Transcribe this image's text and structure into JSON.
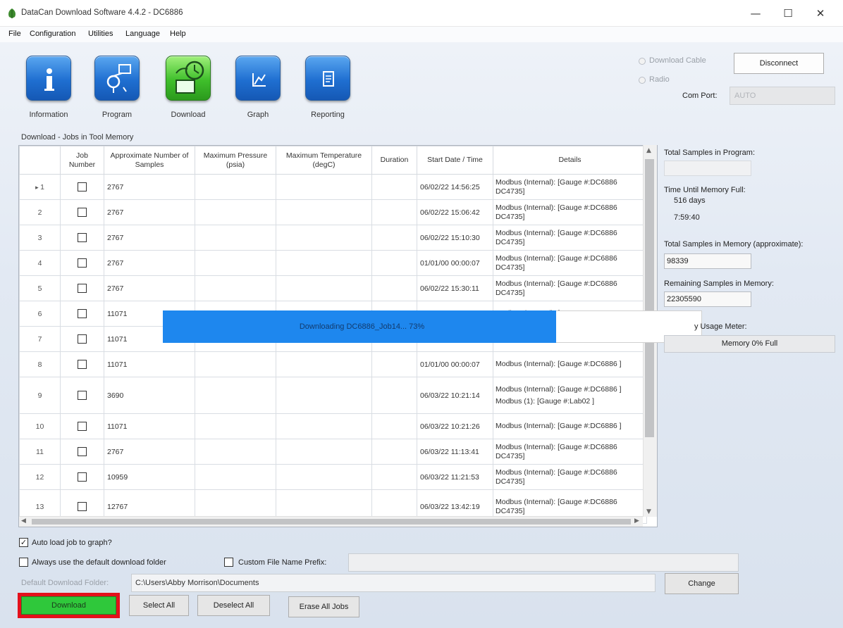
{
  "window": {
    "title": "DataCan Download Software 4.4.2 - DC6886",
    "minimize": "—",
    "maximize": "☐",
    "close": "✕"
  },
  "menu": [
    "File",
    "Configuration",
    "Utilities",
    "Language",
    "Help"
  ],
  "toolbar": [
    {
      "label": "Information",
      "icon": "info-icon"
    },
    {
      "label": "Program",
      "icon": "program-icon"
    },
    {
      "label": "Download",
      "icon": "download-icon"
    },
    {
      "label": "Graph",
      "icon": "graph-icon"
    },
    {
      "label": "Reporting",
      "icon": "reporting-icon"
    }
  ],
  "section_title": "Download - Jobs in Tool Memory",
  "connection": {
    "download_cable_label": "Download Cable",
    "radio_label": "Radio",
    "disconnect_label": "Disconnect",
    "com_port_label": "Com Port:",
    "com_port_value": "AUTO"
  },
  "grid": {
    "headers": {
      "job_number": "Job Number",
      "samples": "Approximate Number of Samples",
      "pressure": "Maximum Pressure (psia)",
      "temperature": "Maximum Temperature (degC)",
      "duration": "Duration",
      "start": "Start Date / Time",
      "details": "Details"
    },
    "rows": [
      {
        "num": "1",
        "samples": "2767",
        "start": "06/02/22 14:56:25",
        "details": "Modbus (Internal): [Gauge #:DC6886 DC4735]",
        "current": true
      },
      {
        "num": "2",
        "samples": "2767",
        "start": "06/02/22 15:06:42",
        "details": "Modbus (Internal): [Gauge #:DC6886 DC4735]"
      },
      {
        "num": "3",
        "samples": "2767",
        "start": "06/02/22 15:10:30",
        "details": "Modbus (Internal): [Gauge #:DC6886 DC4735]"
      },
      {
        "num": "4",
        "samples": "2767",
        "start": "01/01/00 00:00:07",
        "details": "Modbus (Internal): [Gauge #:DC6886 DC4735]"
      },
      {
        "num": "5",
        "samples": "2767",
        "start": "06/02/22 15:30:11",
        "details": "Modbus (Internal): [Gauge #:DC6886 DC4735]"
      },
      {
        "num": "6",
        "samples": "11071",
        "start": "",
        "details": "Modbus (Internal): [Gauge #:DC6886"
      },
      {
        "num": "7",
        "samples": "11071",
        "start": "",
        "details": "]"
      },
      {
        "num": "8",
        "samples": "11071",
        "start": "01/01/00 00:00:07",
        "details": "Modbus (Internal): [Gauge #:DC6886 ]"
      },
      {
        "num": "9",
        "samples": "3690",
        "start": "06/03/22 10:21:14",
        "details": "Modbus (Internal): [Gauge #:DC6886 ]",
        "details2": "Modbus (1): [Gauge #:Lab02 ]"
      },
      {
        "num": "10",
        "samples": "11071",
        "start": "06/03/22 10:21:26",
        "details": "Modbus (Internal): [Gauge #:DC6886 ]"
      },
      {
        "num": "11",
        "samples": "2767",
        "start": "06/03/22 11:13:41",
        "details": "Modbus (Internal): [Gauge #:DC6886 DC4735]"
      },
      {
        "num": "12",
        "samples": "10959",
        "start": "06/03/22 11:21:53",
        "details": "Modbus (Internal): [Gauge #:DC6886 DC4735]"
      },
      {
        "num": "13",
        "samples": "12767",
        "start": "06/03/22 13:42:19",
        "details": "Modbus (Internal): [Gauge #:DC6886 DC4735]"
      }
    ]
  },
  "progress": {
    "text": "Downloading DC6886_Job14... 73%",
    "percent": 73
  },
  "info": {
    "total_samples_in_program_label": "Total Samples in Program:",
    "time_until_full_label": "Time Until Memory Full:",
    "time_days": "516 days",
    "time_hms": "7:59:40",
    "total_samples_memory_label": "Total Samples in Memory (approximate):",
    "total_samples_memory_value": "98339",
    "remaining_label": "Remaining Samples in Memory:",
    "remaining_value": "22305590",
    "usage_meter_label": "y Usage Meter:",
    "usage_meter_value": "Memory 0% Full"
  },
  "options": {
    "auto_load_label": "Auto load job to graph?",
    "auto_load_checked": true,
    "always_default_label": "Always use the default download folder",
    "custom_prefix_label": "Custom File Name Prefix:",
    "default_folder_label": "Default Download Folder:",
    "default_folder_value": "C:\\Users\\Abby Morrison\\Documents",
    "change_label": "Change"
  },
  "buttons": {
    "download": "Download",
    "select_all": "Select All",
    "deselect_all": "Deselect All",
    "erase_all": "Erase All Jobs"
  },
  "colors": {
    "progress_fill": "#1e87ee",
    "download_button": "#2fc83b",
    "highlight_border": "#e4101b"
  }
}
